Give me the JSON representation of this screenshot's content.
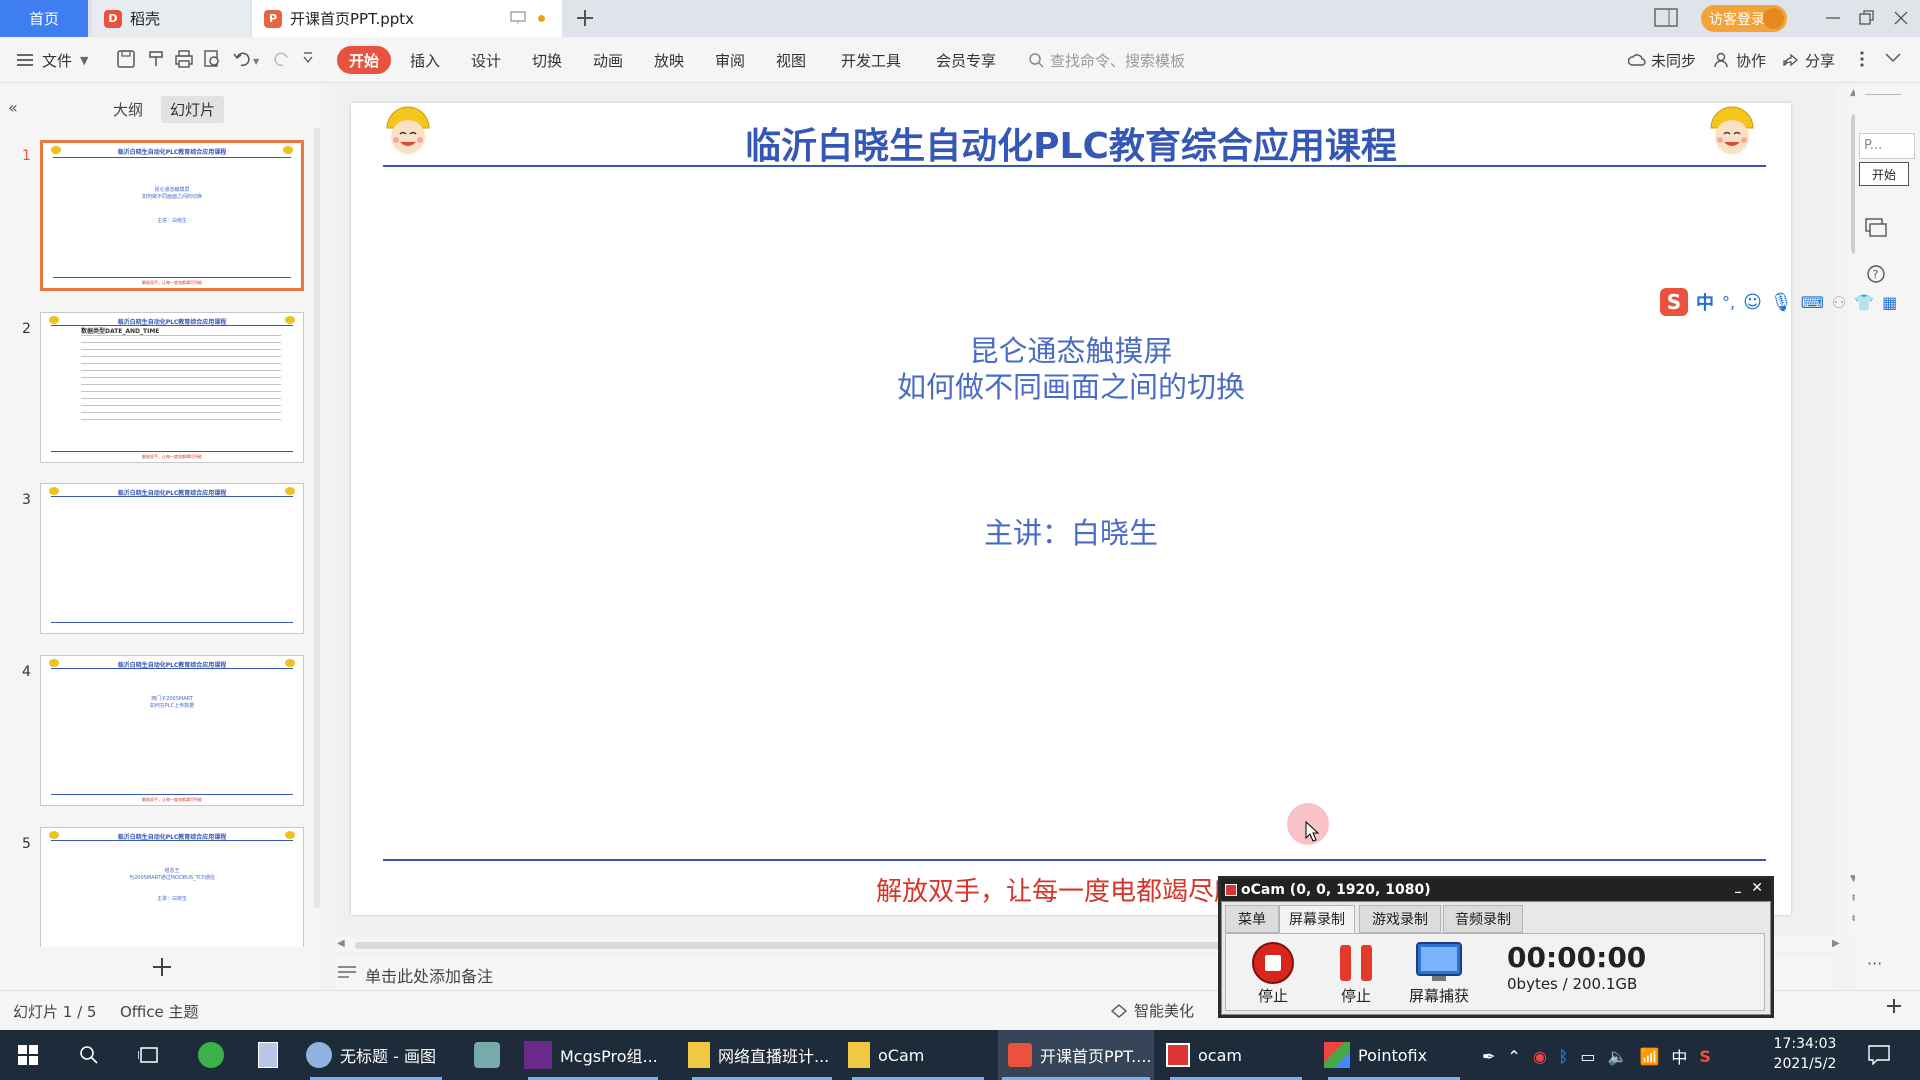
{
  "tabs": {
    "home": "首页",
    "daoke": "稻壳",
    "doc": "开课首页PPT.pptx"
  },
  "titlebar": {
    "login": "访客登录"
  },
  "ribbon": {
    "file": "文件",
    "start": "开始",
    "insert": "插入",
    "design": "设计",
    "transition": "切换",
    "animation": "动画",
    "slideshow": "放映",
    "review": "审阅",
    "view": "视图",
    "devtools": "开发工具",
    "member": "会员专享",
    "search_placeholder": "查找命令、搜索模板",
    "sync": "未同步",
    "collab": "协作",
    "share": "分享"
  },
  "left_panel": {
    "outline_tab": "大纲",
    "slides_tab": "幻灯片",
    "thumbs": [
      {
        "num": "1",
        "title": "临沂白晓生自动化PLC教育综合应用课程",
        "body": [
          "昆仑通态触摸屏",
          "如何做不同画面之间的切换",
          "",
          "主讲：白晓生"
        ],
        "foot": "解放双手，让每一度电都竭尽所能"
      },
      {
        "num": "2",
        "title": "临沂白晓生自动化PLC教育综合应用课程",
        "body": [
          "数据类型DATE_AND_TIME"
        ],
        "foot": "解放双手，让每一度电都竭尽所能"
      },
      {
        "num": "3",
        "title": "临沂白晓生自动化PLC教育综合应用课程",
        "body": [],
        "foot": ""
      },
      {
        "num": "4",
        "title": "临沂白晓生自动化PLC教育综合应用课程",
        "body": [
          "西门子200SMART",
          "如何在PLC上传数据"
        ],
        "foot": "解放双手，让每一度电都竭尽所能"
      },
      {
        "num": "5",
        "title": "临沂白晓生自动化PLC教育综合应用课程",
        "body": [
          "组态王",
          "与200SMART通过MODBUS_TCP通信",
          "",
          "主讲：白晓生"
        ],
        "foot": ""
      }
    ]
  },
  "slide": {
    "title": "临沂白晓生自动化PLC教育综合应用课程",
    "subtitle_line1": "昆仑通态触摸屏",
    "subtitle_line2": "如何做不同画面之间的切换",
    "presenter": "主讲：白晓生",
    "footer": "解放双手，让每一度电都竭尽所能"
  },
  "notes": {
    "placeholder": "单击此处添加备注"
  },
  "status": {
    "slide_pos": "幻灯片 1 / 5",
    "theme": "Office 主题",
    "beautify": "智能美化"
  },
  "right_popup": {
    "text": "P...",
    "button": "开始"
  },
  "ime": {
    "lang": "中",
    "punct": "°,"
  },
  "ocam": {
    "title": "oCam (0, 0, 1920, 1080)",
    "tab_menu": "菜单",
    "tab_screen": "屏幕录制",
    "tab_game": "游戏录制",
    "tab_audio": "音频录制",
    "stop1": "停止",
    "stop2": "停止",
    "capture": "屏幕捕获",
    "time": "00:00:00",
    "size": "0bytes / 200.1GB"
  },
  "taskbar": {
    "apps": [
      {
        "label": "无标题 - 画图"
      },
      {
        "label": "McgsPro组..."
      },
      {
        "label": "网络直播班计..."
      },
      {
        "label": "oCam"
      },
      {
        "label": "开课首页PPT...."
      },
      {
        "label": "ocam"
      },
      {
        "label": "Pointofix"
      }
    ],
    "clock_time": "17:34:03",
    "clock_date": "2021/5/2",
    "ime_lang": "中"
  },
  "colors": {
    "accent_blue": "#3f7ef0",
    "title_blue": "#3557b5",
    "subtitle_blue": "#4a6cc7",
    "footer_red": "#d8342b",
    "start_btn": "#e8523f"
  }
}
